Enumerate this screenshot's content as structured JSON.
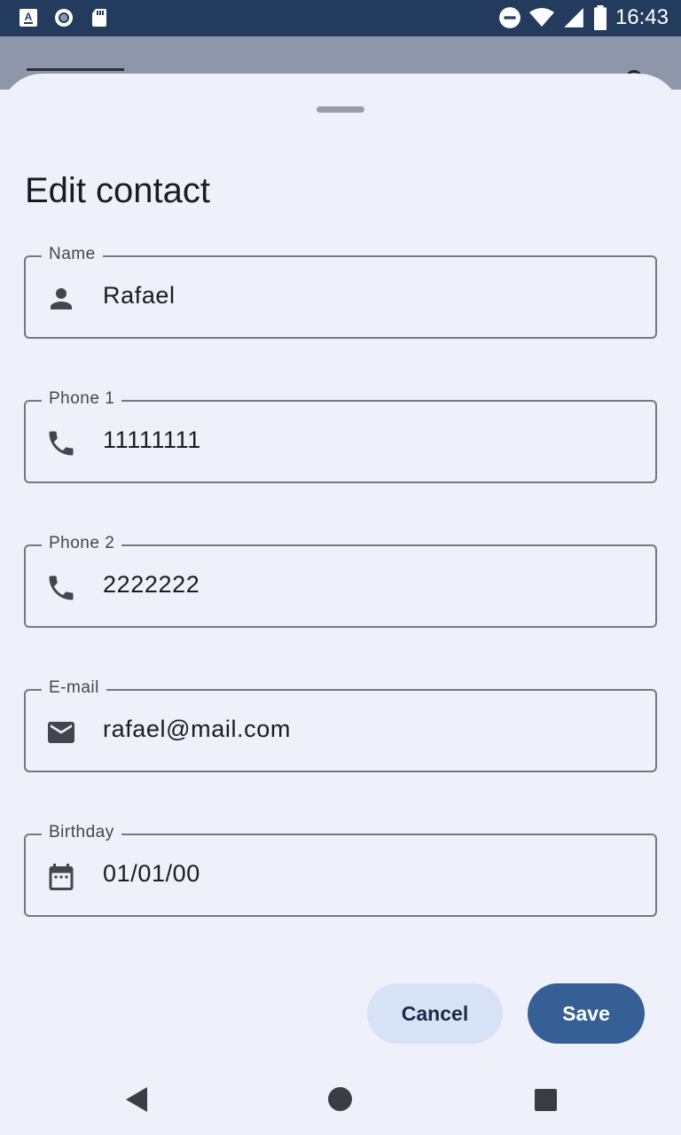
{
  "status_bar": {
    "time": "16:43",
    "left_icons": [
      "a-keyboard-icon",
      "record-icon",
      "sd-card-icon"
    ],
    "right_icons": [
      "dnd-icon",
      "wifi-icon",
      "signal-icon",
      "battery-icon"
    ]
  },
  "sheet": {
    "title": "Edit contact",
    "fields": [
      {
        "label": "Name",
        "value": "Rafael",
        "icon": "person-icon"
      },
      {
        "label": "Phone 1",
        "value": "11111111",
        "icon": "phone-icon"
      },
      {
        "label": "Phone 2",
        "value": "2222222",
        "icon": "phone-icon"
      },
      {
        "label": "E-mail",
        "value": "rafael@mail.com",
        "icon": "email-icon"
      },
      {
        "label": "Birthday",
        "value": "01/01/00",
        "icon": "calendar-icon"
      }
    ],
    "cancel_label": "Cancel",
    "save_label": "Save"
  },
  "colors": {
    "status_bar": "#233c5e",
    "sheet_background": "#eef0fa",
    "save_button": "#365f96",
    "cancel_button": "#d7e2f7"
  },
  "nav_bar": {
    "buttons": [
      "back-icon",
      "home-icon",
      "recents-icon"
    ]
  }
}
